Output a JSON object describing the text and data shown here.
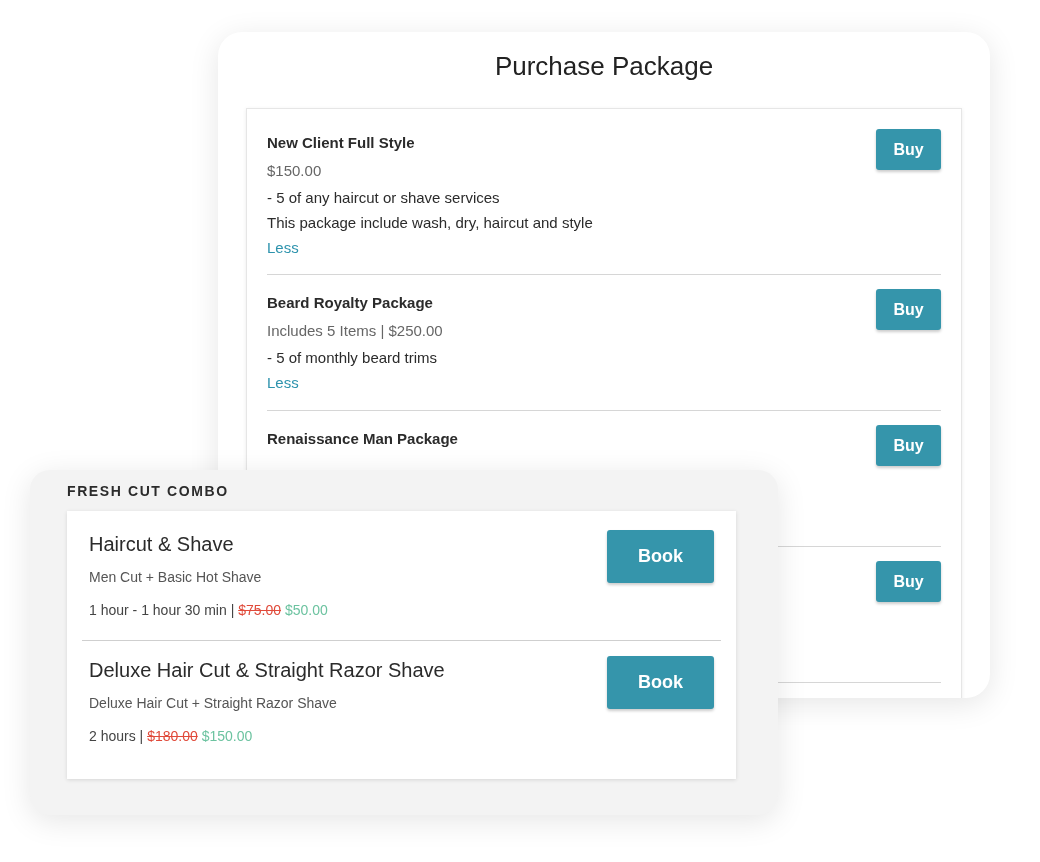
{
  "purchase_package": {
    "title": "Purchase Package",
    "packages": [
      {
        "name": "New Client Full Style",
        "summary": "$150.00",
        "details": [
          "- 5 of any haircut or shave services",
          "This package include wash, dry, haircut and style"
        ],
        "toggle": "Less",
        "button": "Buy"
      },
      {
        "name": "Beard Royalty Package",
        "summary": "Includes 5 Items | $250.00",
        "details": [
          "- 5 of monthly beard trims"
        ],
        "toggle": "Less",
        "button": "Buy"
      },
      {
        "name": "Renaissance Man Package",
        "button": "Buy"
      },
      {
        "button": "Buy"
      }
    ]
  },
  "combo": {
    "heading": "FRESH CUT COMBO",
    "services": [
      {
        "name": "Haircut & Shave",
        "description": "Men Cut + Basic Hot Shave",
        "duration": "1 hour - 1 hour 30 min |",
        "old_price": "$75.00",
        "price": "$50.00",
        "button": "Book"
      },
      {
        "name": "Deluxe Hair Cut & Straight Razor Shave",
        "description": "Deluxe Hair Cut + Straight Razor Shave",
        "duration": "2 hours |",
        "old_price": "$180.00",
        "price": "$150.00",
        "button": "Book"
      }
    ]
  }
}
